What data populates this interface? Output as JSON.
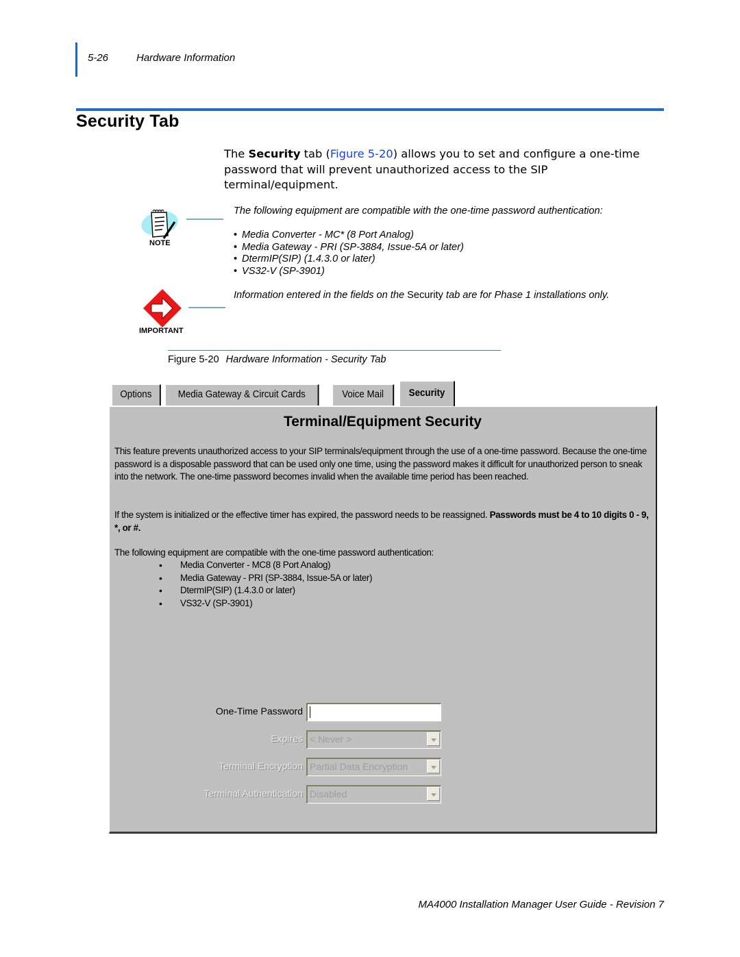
{
  "running_header": {
    "page_number": "5-26",
    "section": "Hardware Information"
  },
  "section_title": "Security Tab",
  "intro": {
    "before": "The ",
    "bold": "Security",
    "middle": " tab (",
    "xref": "Figure 5-20",
    "after": ") allows you to set and configure a one-time password that will prevent unauthorized access to the SIP terminal/equipment."
  },
  "note": {
    "icon": "note-pad-icon",
    "label": "NOTE",
    "text": "The following equipment are compatible with the one-time password authentication:",
    "items": [
      "Media Converter - MC* (8 Port Analog)",
      "Media Gateway - PRI (SP-3884, Issue-5A or later)",
      "DtermIP(SIP) (1.4.3.0 or later)",
      "VS32-V (SP-3901)"
    ]
  },
  "important": {
    "icon": "important-arrow-icon",
    "label": "IMPORTANT",
    "text_before": "Information entered in the fields on the ",
    "text_upright": "Security",
    "text_after": "  tab are for Phase 1 installations only."
  },
  "figure": {
    "number": "Figure 5-20",
    "title": "Hardware Information - Security Tab"
  },
  "app": {
    "tabs": [
      {
        "label": "Options",
        "active": false
      },
      {
        "label": "Media Gateway & Circuit Cards",
        "active": false
      },
      {
        "label": "Voice Mail",
        "active": false
      },
      {
        "label": "Security",
        "active": true
      }
    ],
    "panel_title": "Terminal/Equipment Security",
    "para1": "This feature prevents unauthorized access to your SIP terminals/equipment through the use of a one-time password. Because the one-time password is a disposable password that can be used only one time, using the password makes it difficult for unauthorized person to sneak into the network. The one-time password becomes invalid when the available time period has been reached.",
    "para2_normal": "If the system is initialized or the effective timer has expired, the password needs to be reassigned. ",
    "para2_bold": "Passwords must be 4 to 10 digits 0 - 9, *, or #.",
    "para3": "The following equipment are compatible with the one-time password authentication:",
    "equipment": [
      "Media Converter - MC8 (8 Port Analog)",
      "Media Gateway - PRI (SP-3884, Issue-5A or later)",
      "DtermIP(SIP) (1.4.3.0 or later)",
      "VS32-V (SP-3901)"
    ],
    "fields": {
      "password": {
        "label": "One-Time Password",
        "value": ""
      },
      "expires": {
        "label": "Expires",
        "value": "< Never >",
        "disabled": true
      },
      "encryption": {
        "label": "Terminal Encryption",
        "value": "Partial Data Encryption",
        "disabled": true
      },
      "authentication": {
        "label": "Terminal Authentication",
        "value": "Disabled",
        "disabled": true
      }
    }
  },
  "footer": "MA4000 Installation Manager User Guide - Revision 7"
}
